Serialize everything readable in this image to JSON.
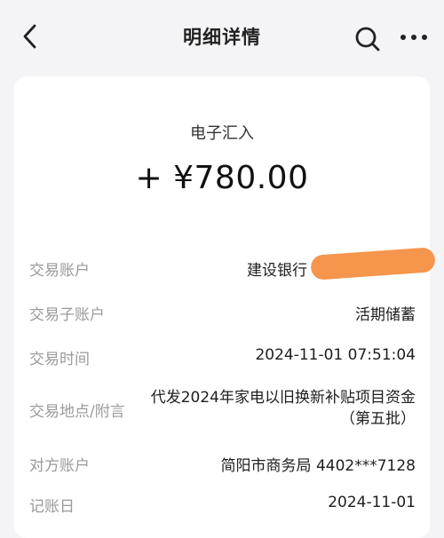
{
  "header": {
    "title": "明细详情",
    "back_icon": "chevron-left-icon",
    "search_icon": "search-icon",
    "more_icon": "more-horizontal-icon"
  },
  "summary": {
    "type": "电子汇入",
    "amount": "+ ¥780.00"
  },
  "details": [
    {
      "label": "交易账户",
      "value": "建设银行"
    },
    {
      "label": "交易子账户",
      "value": "活期储蓄"
    },
    {
      "label": "交易时间",
      "value": "2024-11-01 07:51:04"
    },
    {
      "label": "交易地点/附言",
      "value": "代发2024年家电以旧换新补贴项目资金（第五批）"
    },
    {
      "label": "对方账户",
      "value": "简阳市商务局 4402***7128"
    },
    {
      "label": "记账日",
      "value": "2024-11-01"
    }
  ],
  "colors": {
    "background": "#f4f4f6",
    "card": "#ffffff",
    "label": "#9a9a9a",
    "redaction": "#f6954c"
  }
}
